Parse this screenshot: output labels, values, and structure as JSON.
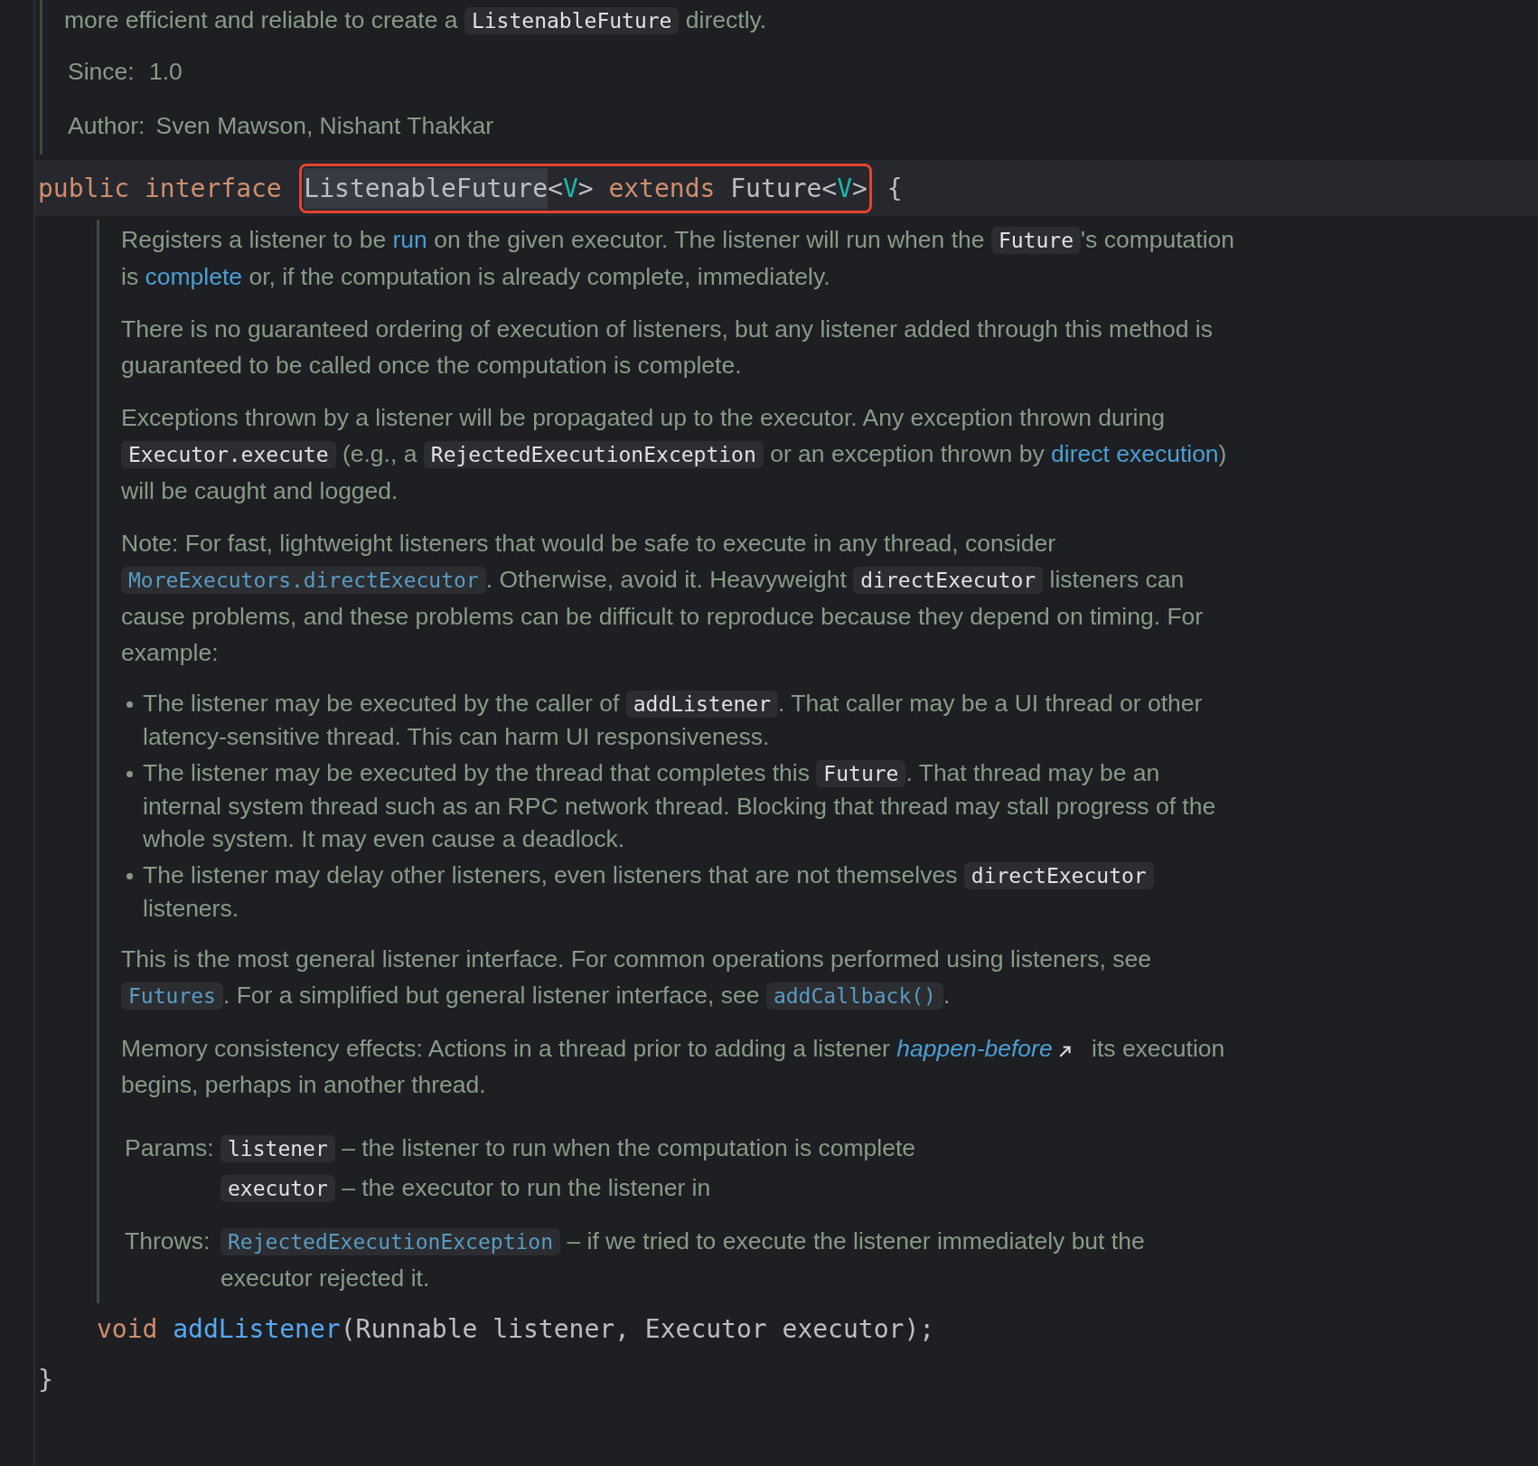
{
  "top_doc": {
    "paragraphs": [
      {
        "segments": [
          {
            "kind": "text",
            "text": "more efficient and reliable to create a "
          },
          {
            "kind": "code",
            "text": "ListenableFuture"
          },
          {
            "kind": "text",
            "text": " directly."
          }
        ]
      }
    ],
    "tags": [
      {
        "label": "Since:",
        "value": "1.0"
      },
      {
        "label": "Author:",
        "value": "Sven Mawson, Nishant Thakkar"
      }
    ]
  },
  "declaration": {
    "current": true,
    "tokens": [
      {
        "kind": "keyword",
        "text": "public interface"
      },
      {
        "kind": "frame",
        "tokens": [
          {
            "kind": "highlighted",
            "text": "ListenableFuture"
          },
          {
            "kind": "plain",
            "text": "<"
          },
          {
            "kind": "generic",
            "text": "V"
          },
          {
            "kind": "plain",
            "text": ">"
          },
          {
            "kind": "keyword",
            "text": "extends"
          },
          {
            "kind": "plain",
            "text": "Future<"
          },
          {
            "kind": "generic",
            "text": "V"
          },
          {
            "kind": "plain",
            "text": ">"
          }
        ]
      },
      {
        "kind": "plain",
        "text": " {"
      }
    ]
  },
  "method_doc": {
    "blocks": [
      {
        "kind": "paragraph",
        "segments": [
          {
            "kind": "text",
            "text": "Registers a listener to be "
          },
          {
            "kind": "link",
            "text": "run"
          },
          {
            "kind": "text",
            "text": " on the given executor. The listener will run when the "
          },
          {
            "kind": "code",
            "text": "Future"
          },
          {
            "kind": "text",
            "text": "'s computation is "
          },
          {
            "kind": "link",
            "text": "complete"
          },
          {
            "kind": "text",
            "text": " or, if the computation is already complete, immediately."
          }
        ]
      },
      {
        "kind": "paragraph",
        "segments": [
          {
            "kind": "text",
            "text": "There is no guaranteed ordering of execution of listeners, but any listener added through this method is guaranteed to be called once the computation is complete."
          }
        ]
      },
      {
        "kind": "paragraph",
        "segments": [
          {
            "kind": "text",
            "text": "Exceptions thrown by a listener will be propagated up to the executor. Any exception thrown during "
          },
          {
            "kind": "code",
            "text": "Executor.execute"
          },
          {
            "kind": "text",
            "text": " (e.g., a "
          },
          {
            "kind": "code",
            "text": "RejectedExecutionException"
          },
          {
            "kind": "text",
            "text": " or an exception thrown by "
          },
          {
            "kind": "link",
            "text": "direct execution"
          },
          {
            "kind": "text",
            "text": ") will be caught and logged."
          }
        ]
      },
      {
        "kind": "paragraph",
        "segments": [
          {
            "kind": "text",
            "text": "Note: For fast, lightweight listeners that would be safe to execute in any thread, consider "
          },
          {
            "kind": "code_link",
            "text": "MoreExecutors.directExecutor"
          },
          {
            "kind": "text",
            "text": ". Otherwise, avoid it. Heavyweight "
          },
          {
            "kind": "code",
            "text": "directExecutor"
          },
          {
            "kind": "text",
            "text": " listeners can cause problems, and these problems can be difficult to reproduce because they depend on timing. For example:"
          }
        ]
      },
      {
        "kind": "list",
        "items": [
          {
            "segments": [
              {
                "kind": "text",
                "text": "The listener may be executed by the caller of "
              },
              {
                "kind": "code",
                "text": "addListener"
              },
              {
                "kind": "text",
                "text": ". That caller may be a UI thread or other latency-sensitive thread. This can harm UI responsiveness."
              }
            ]
          },
          {
            "segments": [
              {
                "kind": "text",
                "text": "The listener may be executed by the thread that completes this "
              },
              {
                "kind": "code",
                "text": "Future"
              },
              {
                "kind": "text",
                "text": ". That thread may be an internal system thread such as an RPC network thread. Blocking that thread may stall progress of the whole system. It may even cause a deadlock."
              }
            ]
          },
          {
            "segments": [
              {
                "kind": "text",
                "text": "The listener may delay other listeners, even listeners that are not themselves "
              },
              {
                "kind": "code",
                "text": "directExecutor"
              },
              {
                "kind": "text",
                "text": " listeners."
              }
            ]
          }
        ]
      },
      {
        "kind": "paragraph",
        "segments": [
          {
            "kind": "text",
            "text": "This is the most general listener interface. For common operations performed using listeners, see "
          },
          {
            "kind": "code_link",
            "text": "Futures"
          },
          {
            "kind": "text",
            "text": ". For a simplified but general listener interface, see "
          },
          {
            "kind": "code_link",
            "text": "addCallback()"
          },
          {
            "kind": "text",
            "text": "."
          }
        ]
      },
      {
        "kind": "paragraph",
        "segments": [
          {
            "kind": "text",
            "text": "Memory consistency effects: Actions in a thread prior to adding a listener "
          },
          {
            "kind": "external_link",
            "text": "happen-before"
          },
          {
            "kind": "text",
            "text": " its execution begins, perhaps in another thread."
          }
        ]
      }
    ],
    "tags": [
      {
        "label": "Params:",
        "entries": [
          {
            "kind": "code",
            "name": "listener",
            "description": "– the listener to run when the computation is complete"
          },
          {
            "kind": "code",
            "name": "executor",
            "description": "– the executor to run the listener in"
          }
        ]
      },
      {
        "label": "Throws:",
        "entries": [
          {
            "kind": "code_link",
            "name": "RejectedExecutionException",
            "description": "– if we tried to execute the listener immediately but the executor rejected it."
          }
        ]
      }
    ]
  },
  "method_signature": {
    "current": false,
    "tokens": [
      {
        "kind": "keyword",
        "text": "void"
      },
      {
        "kind": "method",
        "text": "addListener"
      },
      {
        "kind": "plain",
        "text": "(Runnable listener, Executor executor);"
      }
    ]
  },
  "closing_line": {
    "current": false,
    "tokens": [
      {
        "kind": "plain",
        "text": "}"
      }
    ]
  }
}
